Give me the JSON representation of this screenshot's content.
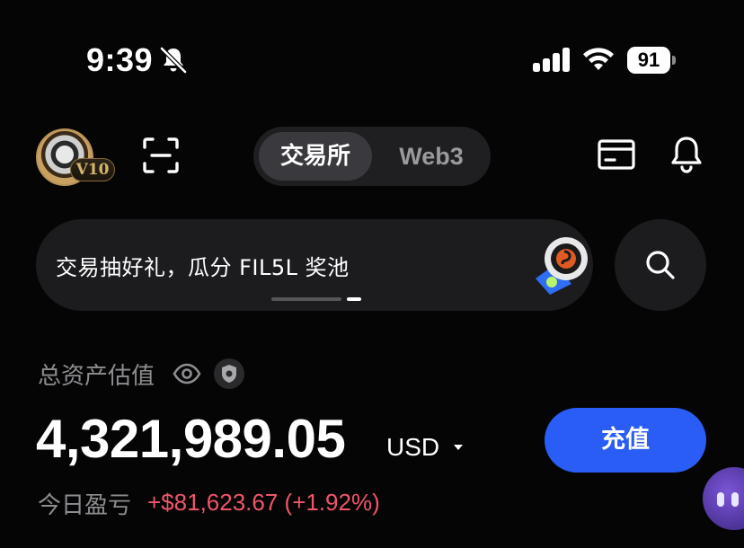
{
  "status_bar": {
    "time": "9:39",
    "battery_level": "91",
    "icons": [
      "bell-off-icon",
      "signal-icon",
      "wifi-icon",
      "battery-icon"
    ]
  },
  "header": {
    "vip_level": "V10",
    "tabs": [
      {
        "label": "交易所",
        "active": true
      },
      {
        "label": "Web3",
        "active": false
      }
    ],
    "icons": [
      "avatar",
      "scan-icon",
      "card-icon",
      "notification-bell-icon"
    ]
  },
  "banner": {
    "text": "交易抽好礼，瓜分 FIL5L 奖池",
    "icons": [
      "search-icon"
    ]
  },
  "assets": {
    "label": "总资产估值",
    "balance": "4,321,989.05",
    "currency": "USD",
    "deposit_label": "充值",
    "pnl_label": "今日盈亏",
    "pnl_value": "+$81,623.67 (+1.92%)",
    "icons": [
      "eye-icon",
      "shield-icon",
      "chevron-down-icon"
    ]
  },
  "colors": {
    "background": "#050505",
    "accent": "#2a5df5",
    "loss_profit_red": "#f0556a",
    "muted_text": "#8e8e92",
    "card": "#1c1c1f"
  }
}
